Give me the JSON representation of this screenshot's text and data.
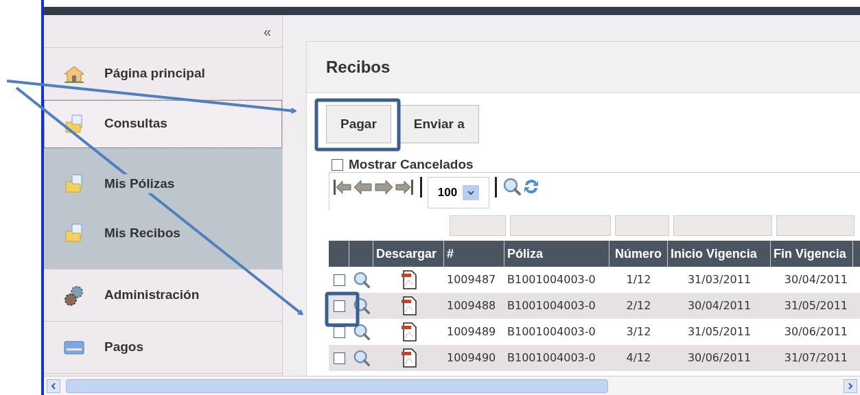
{
  "sidebar": {
    "collapse_glyph": "«",
    "items": [
      {
        "label": "Página principal",
        "kind": "home",
        "selected": false
      },
      {
        "label": "Consultas",
        "kind": "folder",
        "selected": true,
        "expanded": true,
        "children": [
          {
            "label": "Mis Pólizas",
            "kind": "folder",
            "selected": false
          },
          {
            "label": "Mis Recibos",
            "kind": "folder",
            "selected": false
          }
        ]
      },
      {
        "label": "Administración",
        "kind": "gears",
        "selected": false
      },
      {
        "label": "Pagos",
        "kind": "card",
        "selected": false
      }
    ]
  },
  "panel": {
    "title": "Recibos",
    "buttons": [
      "Pagar",
      "Enviar a"
    ],
    "show_cancelled": {
      "label": "Mostrar Cancelados",
      "checked": false
    },
    "pager": {
      "page_size": "100"
    },
    "table": {
      "columns": [
        "",
        "",
        "Descargar",
        "#",
        "Póliza",
        "Número",
        "Inicio Vigencia",
        "Fin Vigencia"
      ],
      "rows": [
        {
          "checked": false,
          "cells": [
            "",
            "",
            "",
            "1009487",
            "B1001004003-0",
            "1/12",
            "31/03/2011",
            "30/04/2011"
          ]
        },
        {
          "checked": false,
          "cells": [
            "",
            "",
            "",
            "1009488",
            "B1001004003-0",
            "2/12",
            "30/04/2011",
            "31/05/2011"
          ]
        },
        {
          "checked": false,
          "cells": [
            "",
            "",
            "",
            "1009489",
            "B1001004003-0",
            "3/12",
            "31/05/2011",
            "30/06/2011"
          ]
        },
        {
          "checked": false,
          "cells": [
            "",
            "",
            "",
            "1009490",
            "B1001004003-0",
            "4/12",
            "30/06/2011",
            "31/07/2011"
          ]
        }
      ]
    }
  }
}
